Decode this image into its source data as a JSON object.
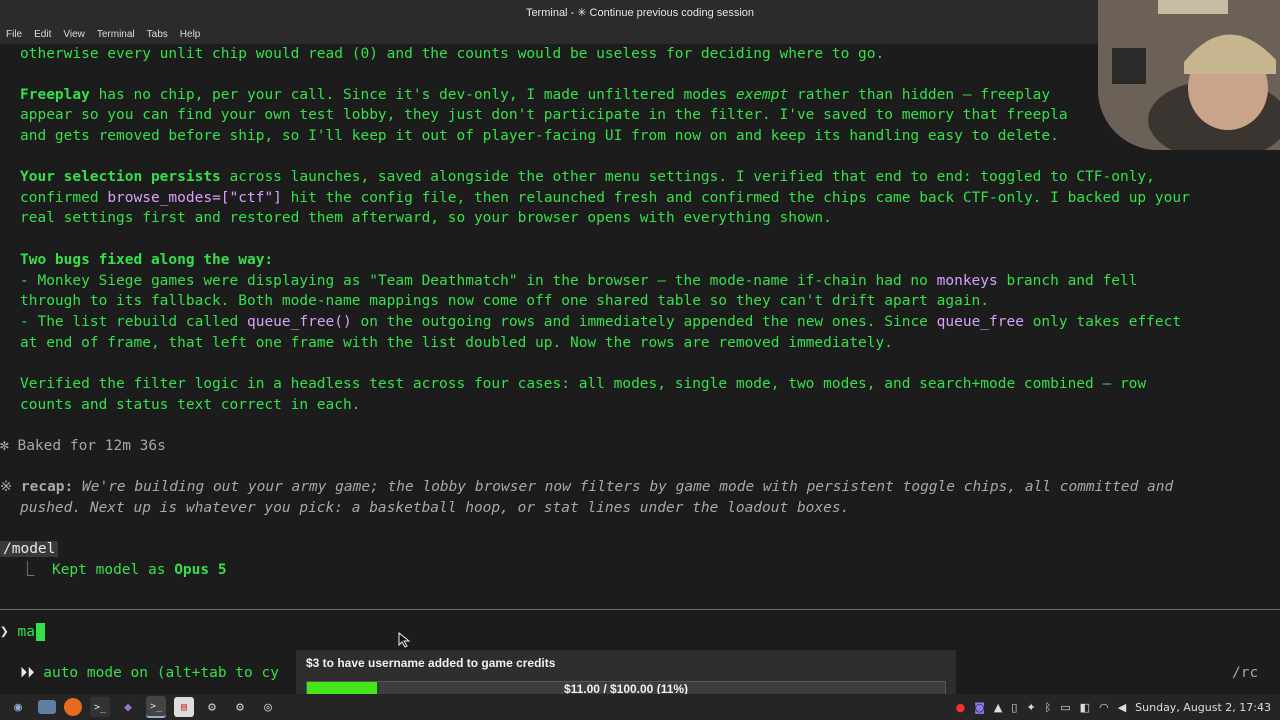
{
  "window": {
    "title": "Terminal - ✳ Continue previous coding session"
  },
  "menu": [
    "File",
    "Edit",
    "View",
    "Terminal",
    "Tabs",
    "Help"
  ],
  "terminal": {
    "l1": "otherwise every unlit chip would read (0) and the counts would be useless for deciding where to go.",
    "freeplay_head": "Freeplay",
    "freeplay_a": " has no chip, per your call. Since it's dev-only, I made unfiltered modes ",
    "freeplay_exempt": "exempt",
    "freeplay_b": " rather than hidden — freeplay",
    "freeplay_l2": "appear so you can find your own test lobby, they just don't participate in the filter. I've saved to memory that freepla",
    "freeplay_l3": "and gets removed before ship, so I'll keep it out of player-facing UI from now on and keep its handling easy to delete.",
    "persist_head": "Your selection persists",
    "persist_a": " across launches, saved alongside the other menu settings. I verified that end to end: toggled to CTF-only,",
    "persist_l2a": "confirmed ",
    "persist_code": "browse_modes=[\"ctf\"]",
    "persist_l2b": " hit the config file, then relaunched fresh and confirmed the chips came back CTF-only. I backed up your",
    "persist_l3": "real settings first and restored them afterward, so your browser opens with everything shown.",
    "bugs_head": "Two bugs fixed along the way:",
    "bug1_a": "- Monkey Siege games were displaying as \"Team Deathmatch\" in the browser — the mode-name if-chain had no ",
    "bug1_code": "monkeys",
    "bug1_b": " branch and fell",
    "bug1_l2": "through to its fallback. Both mode-name mappings now come off one shared table so they can't drift apart again.",
    "bug2_a": "- The list rebuild called ",
    "bug2_code1": "queue_free()",
    "bug2_b": " on the outgoing rows and immediately appended the new ones. Since ",
    "bug2_code2": "queue_free",
    "bug2_c": " only takes effect",
    "bug2_l2": "at end of frame, that left one frame with the list doubled up. Now the rows are removed immediately.",
    "verify_l1": "Verified the filter logic in a headless test across four cases: all modes, single mode, two modes, and search+mode combined — row",
    "verify_l2": "counts and status text correct in each.",
    "baked": "✻ Baked for 12m 36s",
    "recap_sym": "※ ",
    "recap_head": "recap:",
    "recap_a": " We're building out your army game; the lobby browser now filters by game mode with persistent toggle chips, all committed and",
    "recap_l2": "pushed. Next up is whatever you pick: a basketball hoop, or stat lines under the loadout boxes.",
    "slash_cmd": "/model",
    "model_tree": "⎿  ",
    "model_a": "Kept model as ",
    "model_name": "Opus 5",
    "prompt_sym": "❯ ",
    "prompt_input": "ma",
    "auto_sym": "⏵⏵ ",
    "auto_text": "auto mode on (alt+tab to cy",
    "rc": "/rc"
  },
  "donation": {
    "label": "$3 to have username added to game credits",
    "progress_text": "$11.00 / $100.00 (11%)",
    "progress_fraction": 0.11,
    "fill_color": "#43e61a"
  },
  "taskbar": {
    "clock": "Sunday, August  2, 17:43",
    "icons": [
      "menu-icon",
      "file-manager-icon",
      "firefox-icon",
      "terminal-icon",
      "editor-icon",
      "terminal-active-icon",
      "document-icon",
      "game-icon",
      "game2-icon",
      "settings-icon"
    ]
  },
  "colors": {
    "terminal_green": "#35e04a",
    "code_purple": "#d8a0ff",
    "background": "#1c1c1c"
  }
}
